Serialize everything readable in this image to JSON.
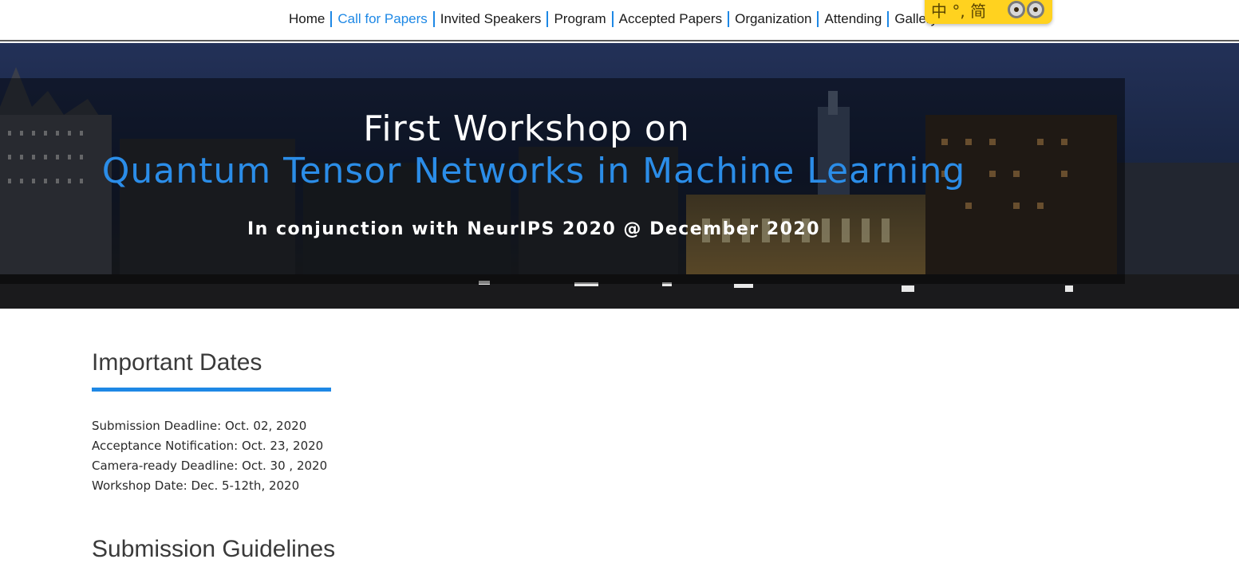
{
  "nav": {
    "items": [
      {
        "label": "Home",
        "active": false
      },
      {
        "label": "Call for Papers",
        "active": true
      },
      {
        "label": "Invited Speakers",
        "active": false
      },
      {
        "label": "Program",
        "active": false
      },
      {
        "label": "Accepted Papers",
        "active": false
      },
      {
        "label": "Organization",
        "active": false
      },
      {
        "label": "Attending",
        "active": false
      },
      {
        "label": "Gallery",
        "active": false
      }
    ],
    "accent_color": "#1e88e5"
  },
  "ime_toolbar": {
    "text": "中 °, 简",
    "icon": "minion-mascot-icon"
  },
  "banner": {
    "line1": "First Workshop on",
    "line2": "Quantum Tensor Networks in Machine Learning",
    "line3": "In conjunction with NeurIPS 2020 @ December 2020",
    "title_color": "#2b8de8"
  },
  "important_dates": {
    "title": "Important Dates",
    "items": [
      "Submission Deadline: Oct. 02, 2020",
      "Acceptance Notification: Oct. 23, 2020",
      "Camera-ready Deadline: Oct. 30 , 2020",
      "Workshop Date: Dec. 5-12th, 2020"
    ]
  },
  "next_section": {
    "title": "Submission Guidelines"
  }
}
